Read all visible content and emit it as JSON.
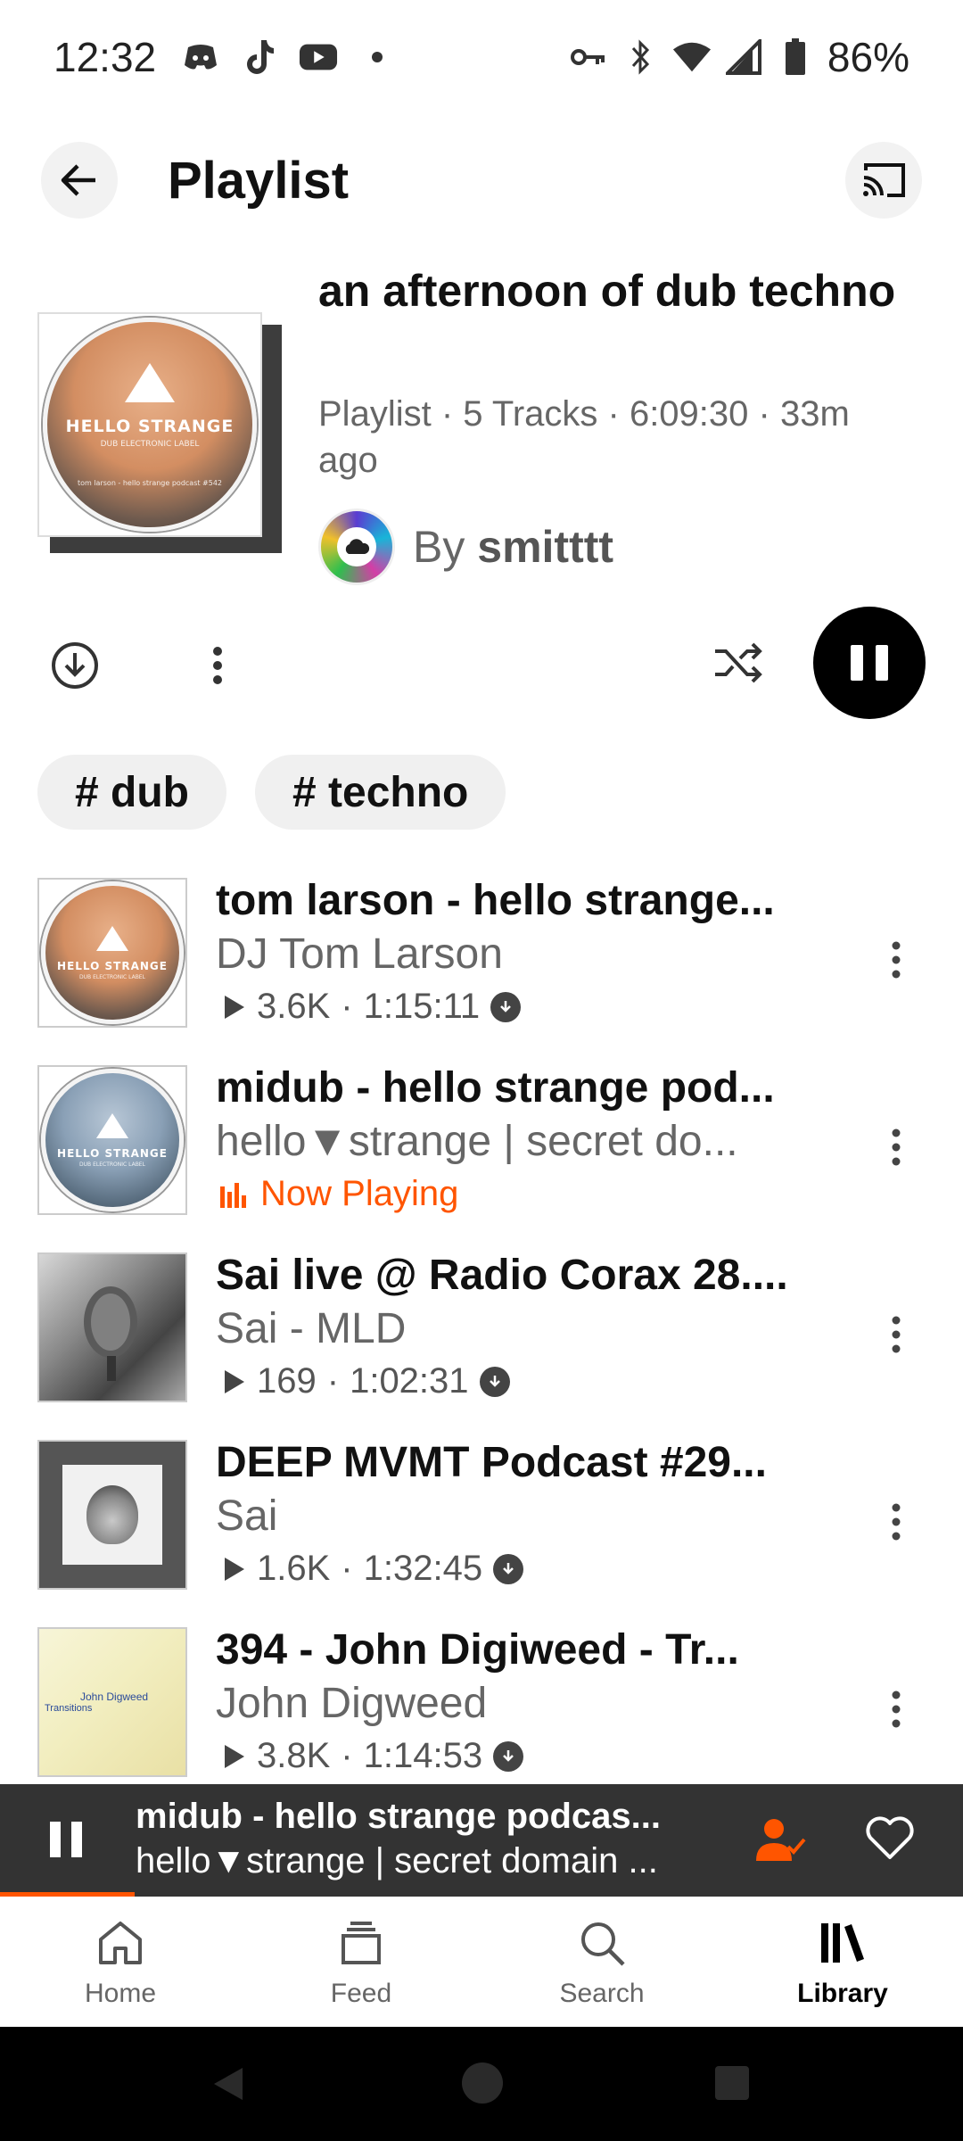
{
  "status_bar": {
    "time": "12:32",
    "battery": "86%",
    "left_icons": [
      "discord-icon",
      "tiktok-icon",
      "youtube-icon",
      "dot-icon"
    ],
    "right_icons": [
      "vpn-key-icon",
      "bluetooth-icon",
      "wifi-icon",
      "signal-icon",
      "battery-icon"
    ]
  },
  "header": {
    "title": "Playlist"
  },
  "playlist": {
    "title": "an afternoon of dub techno",
    "meta": "Playlist · 5 Tracks · 6:09:30 · 33m ago",
    "by_label": "By",
    "owner": "smitttt",
    "cover_brand": "HELLO STRANGE",
    "cover_sub": "DUB ELECTRONIC LABEL",
    "cover_caption": "tom larson - hello strange podcast #542"
  },
  "tags": [
    "# dub",
    "# techno"
  ],
  "tracks": [
    {
      "title": "tom larson - hello strange...",
      "artist": "DJ Tom Larson",
      "plays": "3.6K",
      "duration": "1:15:11",
      "now_playing": false
    },
    {
      "title": "midub - hello strange pod...",
      "artist": "hello▼strange | secret do...",
      "now_playing": true,
      "now_playing_label": "Now Playing"
    },
    {
      "title": "Sai live @ Radio Corax 28....",
      "artist": "Sai - MLD",
      "plays": "169",
      "duration": "1:02:31",
      "now_playing": false
    },
    {
      "title": "DEEP MVMT Podcast #29...",
      "artist": "Sai",
      "plays": "1.6K",
      "duration": "1:32:45",
      "now_playing": false
    },
    {
      "title": "394 - John Digiweed - Tr...",
      "artist": "John Digweed",
      "plays": "3.8K",
      "duration": "1:14:53",
      "now_playing": false
    }
  ],
  "art_text": {
    "digweed_name": "John Digweed",
    "digweed_sub": "Transitions"
  },
  "mini_player": {
    "title": "midub - hello strange podcas...",
    "subtitle": "hello▼strange | secret domain ...",
    "progress": 0.14
  },
  "bottom_nav": [
    {
      "label": "Home",
      "icon": "home-icon",
      "active": false
    },
    {
      "label": "Feed",
      "icon": "feed-icon",
      "active": false
    },
    {
      "label": "Search",
      "icon": "search-icon",
      "active": false
    },
    {
      "label": "Library",
      "icon": "library-icon",
      "active": true
    }
  ],
  "colors": {
    "accent": "#ff5500",
    "mini_player_bg": "#333333",
    "primary_button": "#000000"
  }
}
